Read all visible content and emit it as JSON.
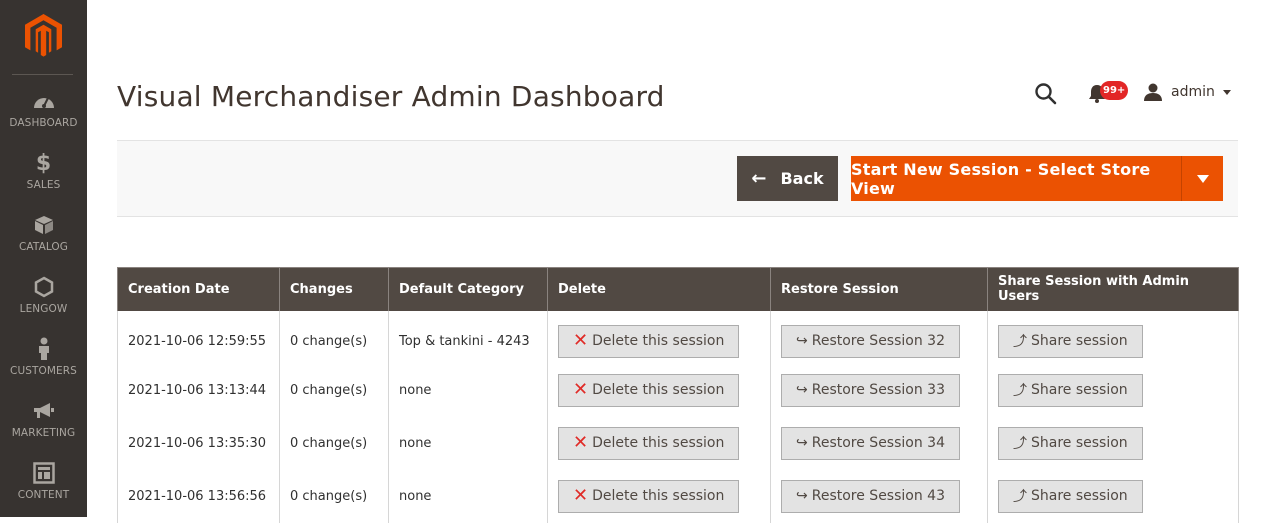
{
  "sidebar": {
    "items": [
      {
        "label": "DASHBOARD",
        "icon": "dashboard-icon"
      },
      {
        "label": "SALES",
        "icon": "dollar-icon"
      },
      {
        "label": "CATALOG",
        "icon": "box-icon"
      },
      {
        "label": "LENGOW",
        "icon": "hexagon-icon"
      },
      {
        "label": "CUSTOMERS",
        "icon": "person-icon"
      },
      {
        "label": "MARKETING",
        "icon": "megaphone-icon"
      },
      {
        "label": "CONTENT",
        "icon": "layout-icon"
      }
    ]
  },
  "header": {
    "title": "Visual Merchandiser Admin Dashboard",
    "notifications_badge": "99+",
    "user": "admin"
  },
  "actions": {
    "back_label": "Back",
    "start_label": "Start New Session - Select Store View"
  },
  "table": {
    "columns": [
      "Creation Date",
      "Changes",
      "Default Category",
      "Delete",
      "Restore Session",
      "Share Session with Admin Users"
    ],
    "rows": [
      {
        "date": "2021-10-06 12:59:55",
        "changes": "0 change(s)",
        "category": "Top & tankini - 4243",
        "delete": "Delete this session",
        "restore": "Restore Session 32",
        "share": "Share session"
      },
      {
        "date": "2021-10-06 13:13:44",
        "changes": "0 change(s)",
        "category": "none",
        "delete": "Delete this session",
        "restore": "Restore Session 33",
        "share": "Share session"
      },
      {
        "date": "2021-10-06 13:35:30",
        "changes": "0 change(s)",
        "category": "none",
        "delete": "Delete this session",
        "restore": "Restore Session 34",
        "share": "Share session"
      },
      {
        "date": "2021-10-06 13:56:56",
        "changes": "0 change(s)",
        "category": "none",
        "delete": "Delete this session",
        "restore": "Restore Session 43",
        "share": "Share session"
      }
    ]
  },
  "colors": {
    "sidebar_bg": "#373330",
    "accent_orange": "#eb5202",
    "dark_button": "#514943",
    "delete_red": "#e02b27"
  }
}
